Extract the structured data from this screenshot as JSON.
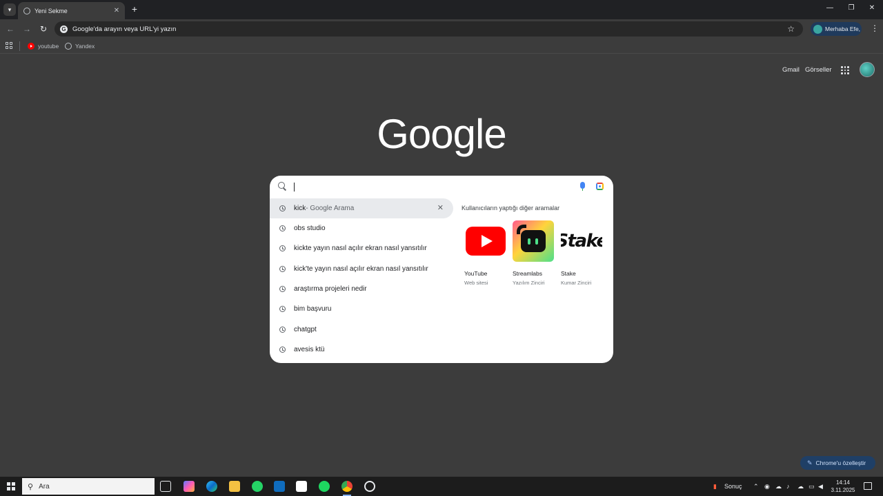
{
  "browser": {
    "tab_title": "Yeni Sekme",
    "new_tab_symbol": "+",
    "window_controls": {
      "minimize": "—",
      "restore": "❐",
      "close": "✕"
    },
    "omnibox_placeholder": "Google'da arayın veya URL'yi yazın",
    "profile_label": "Merhaba Efe,",
    "bookmarks": [
      {
        "label": "youtube"
      },
      {
        "label": "Yandex"
      }
    ]
  },
  "google": {
    "header_links": {
      "gmail": "Gmail",
      "images": "Görseller"
    },
    "logo": "Google",
    "suggestions": [
      {
        "text": "kick",
        "suffix": " - Google Arama",
        "highlighted": true
      },
      {
        "text": "obs studio"
      },
      {
        "text": "kickte yayın nasıl açılır ekran nasıl yansıtılır"
      },
      {
        "text": "kick'te yayın nasıl açılır ekran nasıl yansıtılır"
      },
      {
        "text": "araştırma projeleri nedir"
      },
      {
        "text": "bim başvuru"
      },
      {
        "text": "chatgpt"
      },
      {
        "text": "avesis ktü"
      }
    ],
    "related_title": "Kullanıcıların yaptığı diğer aramalar",
    "related": [
      {
        "name": "YouTube",
        "sub": "Web sitesi"
      },
      {
        "name": "Streamlabs",
        "sub": "Yazılım Zinciri"
      },
      {
        "name": "Stake",
        "sub": "Kumar Zinciri",
        "logo_text": "Stake"
      }
    ],
    "customize_label": "Chrome'u özelleştir"
  },
  "taskbar": {
    "search_label": "Ara",
    "weather_label": "Sonuç",
    "time": "14:14",
    "date": "3.11.2025"
  },
  "colors": {
    "page_bg": "#3c3c3c",
    "titlebar_bg": "#202124",
    "dropdown_bg": "#ffffff",
    "youtube_red": "#ff0000",
    "chip_blue": "#1f3f66"
  }
}
